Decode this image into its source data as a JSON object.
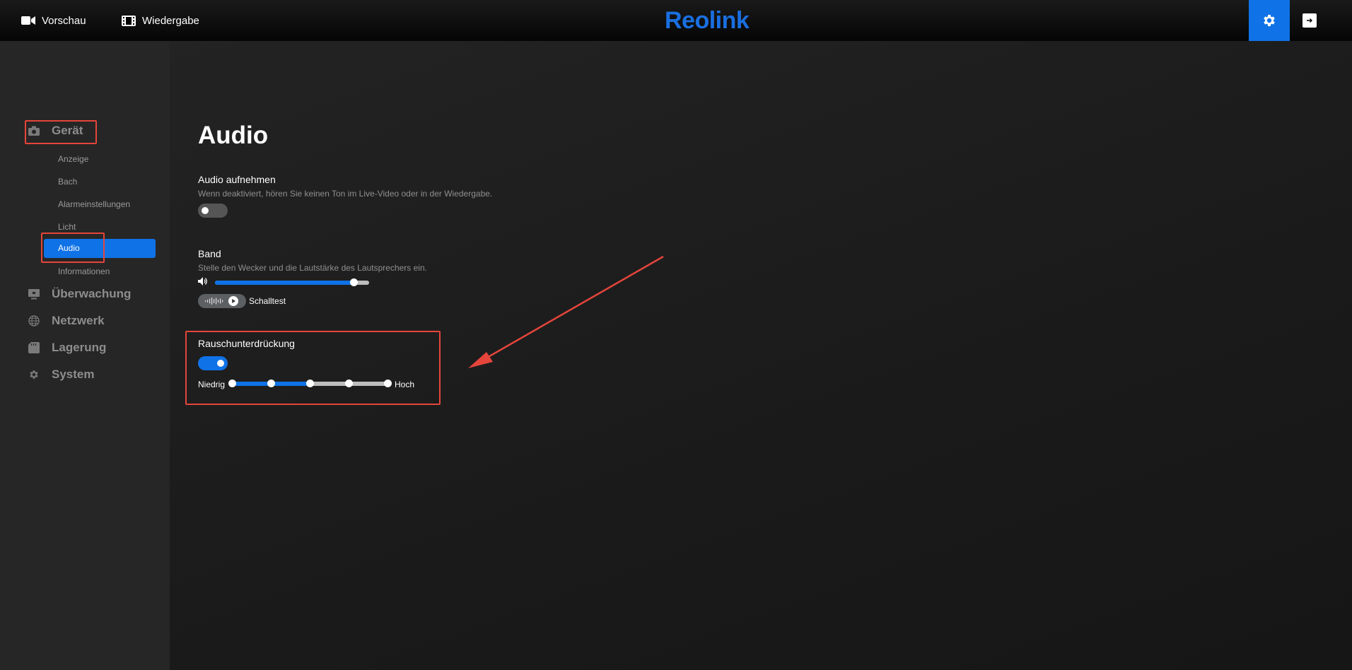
{
  "topbar": {
    "preview_label": "Vorschau",
    "playback_label": "Wiedergabe",
    "logo_text": "Reolink",
    "settings_icon": "gear-icon",
    "logout_icon": "logout-icon"
  },
  "sidebar": {
    "categories": [
      {
        "label": "Gerät",
        "icon": "camera-icon"
      },
      {
        "label": "Überwachung",
        "icon": "monitor-icon"
      },
      {
        "label": "Netzwerk",
        "icon": "globe-icon"
      },
      {
        "label": "Lagerung",
        "icon": "storage-icon"
      },
      {
        "label": "System",
        "icon": "gear-icon"
      }
    ],
    "device_items": [
      "Anzeige",
      "Bach",
      "Alarmeinstellungen",
      "Licht",
      "Audio",
      "Informationen"
    ],
    "active_item": "Audio"
  },
  "main": {
    "title": "Audio",
    "record_audio": {
      "title": "Audio aufnehmen",
      "description": "Wenn deaktiviert, hören Sie keinen Ton im Live-Video oder in der Wiedergabe.",
      "enabled": false
    },
    "volume": {
      "title": "Band",
      "description": "Stelle den Wecker und die Lautstärke des Lautsprechers ein.",
      "level_percent": 90,
      "sound_test_label": "Schalltest"
    },
    "noise_reduction": {
      "title": "Rauschunterdrückung",
      "enabled": true,
      "low_label": "Niedrig",
      "high_label": "Hoch",
      "level_step": 3,
      "steps": 5
    }
  },
  "colors": {
    "accent": "#0f72e6",
    "annotation": "#e5453b",
    "background": "#1c1c1c",
    "sidebar": "#262626"
  }
}
